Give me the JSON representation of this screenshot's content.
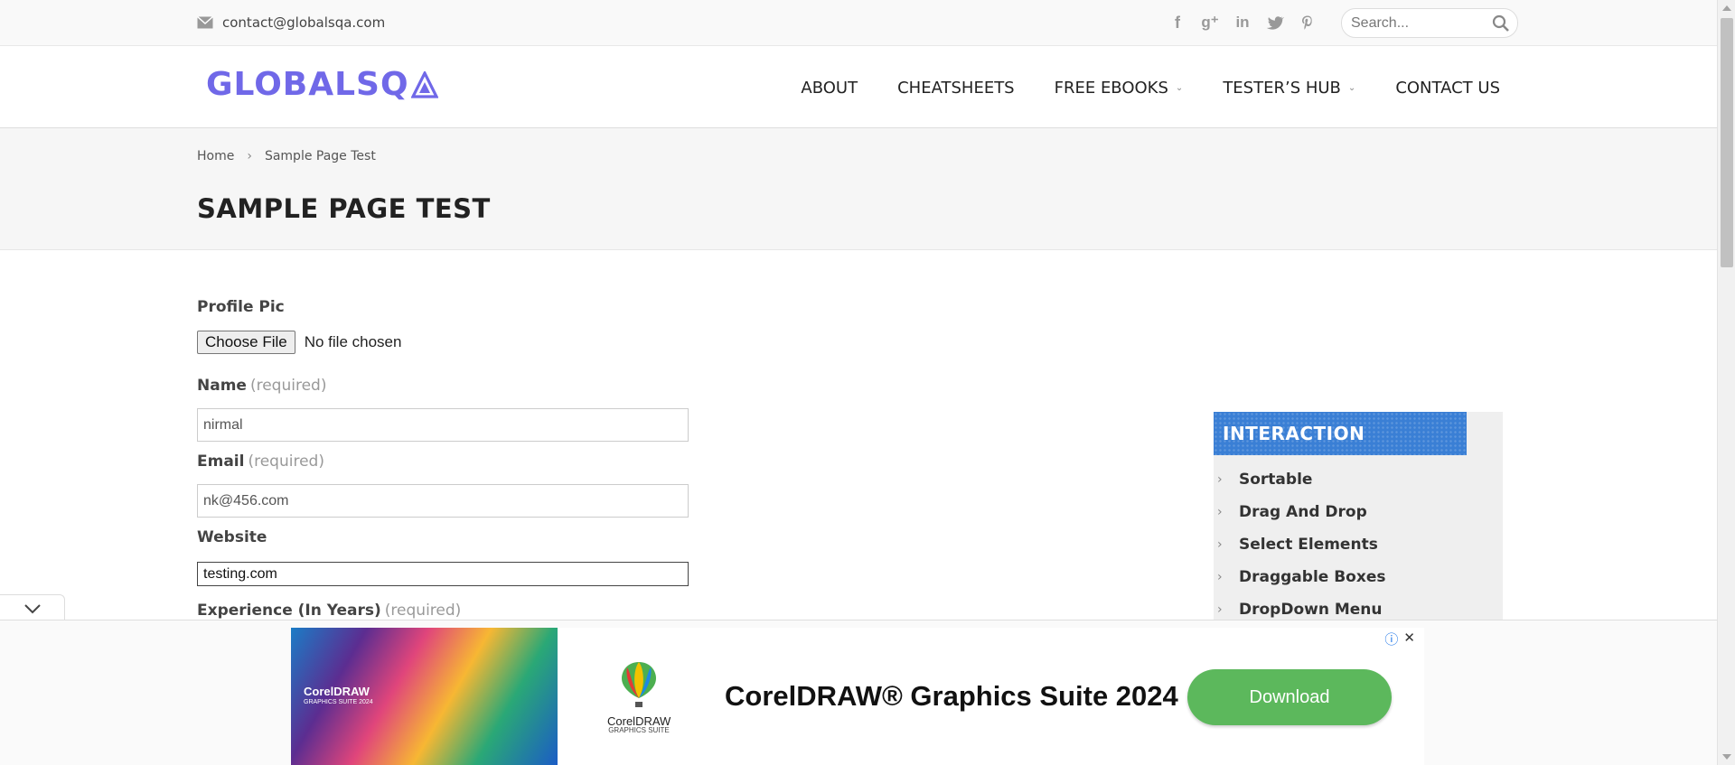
{
  "topbar": {
    "email": "contact@globalsqa.com",
    "social": [
      "facebook-icon",
      "google-plus-icon",
      "linkedin-icon",
      "twitter-icon",
      "pinterest-icon"
    ],
    "search_placeholder": "Search..."
  },
  "header": {
    "logo": "GLOBALSQ",
    "nav": [
      {
        "label": "ABOUT",
        "dropdown": false
      },
      {
        "label": "CHEATSHEETS",
        "dropdown": false
      },
      {
        "label": "FREE EBOOKS",
        "dropdown": true
      },
      {
        "label": "TESTER’S HUB",
        "dropdown": true
      },
      {
        "label": "CONTACT US",
        "dropdown": false
      }
    ]
  },
  "breadcrumb": {
    "home": "Home",
    "separator": "›",
    "current": "Sample Page Test"
  },
  "page_title": "SAMPLE PAGE TEST",
  "form": {
    "profile_pic_label": "Profile Pic",
    "choose_file_label": "Choose File",
    "no_file_text": "No file chosen",
    "name_label": "Name",
    "name_required": "(required)",
    "name_value": "nirmal",
    "email_label": "Email",
    "email_required": "(required)",
    "email_value": "nk@456.com",
    "website_label": "Website",
    "website_value": "testing.com",
    "experience_label": "Experience (In Years)",
    "experience_required": "(required)"
  },
  "sidebar": {
    "heading": "INTERACTION",
    "items": [
      "Sortable",
      "Drag And Drop",
      "Select Elements",
      "Draggable Boxes",
      "DropDown Menu"
    ]
  },
  "ad": {
    "image_brand": "CorelDRAW",
    "image_brand_sub": "GRAPHICS SUITE 2024",
    "logo_text": "CorelDRAW",
    "logo_sub": "GRAPHICS SUITE",
    "title": "CorelDRAW® Graphics Suite 2024",
    "button": "Download",
    "accent": "#5cb85c"
  },
  "colors": {
    "logo": "#7068e8",
    "sidebar_head": "#3a7fd5"
  }
}
